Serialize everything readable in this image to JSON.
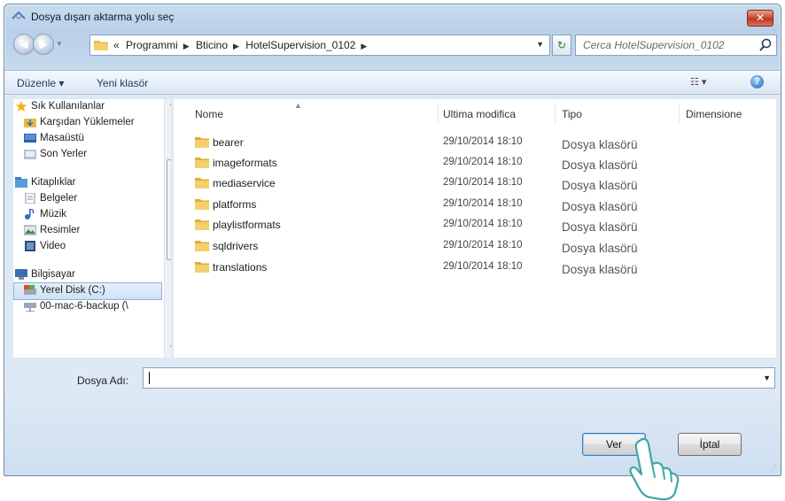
{
  "window": {
    "title": "Dosya dışarı aktarma yolu seç",
    "close_label": "✕"
  },
  "address": {
    "prefix": "«",
    "crumbs": [
      "Programmi",
      "Bticino",
      "HotelSupervision_0102"
    ],
    "search_placeholder": "Cerca HotelSupervision_0102"
  },
  "toolbar": {
    "organize": "Düzenle ▾",
    "new_folder": "Yeni klasör",
    "views_label": "☷ ▾",
    "help_label": "?"
  },
  "sidebar": {
    "items": [
      {
        "label": "Sık Kullanılanlar",
        "icon": "star-icon"
      },
      {
        "label": "Karşıdan Yüklemeler",
        "icon": "download-folder-icon"
      },
      {
        "label": "Masaüstü",
        "icon": "desktop-icon"
      },
      {
        "label": "Son Yerler",
        "icon": "recent-places-icon"
      },
      {
        "label": "Kitaplıklar",
        "icon": "libraries-icon"
      },
      {
        "label": "Belgeler",
        "icon": "documents-icon"
      },
      {
        "label": "Müzik",
        "icon": "music-icon"
      },
      {
        "label": "Resimler",
        "icon": "pictures-icon"
      },
      {
        "label": "Video",
        "icon": "video-icon"
      },
      {
        "label": "Bilgisayar",
        "icon": "computer-icon"
      },
      {
        "label": "Yerel Disk (C:)",
        "icon": "drive-icon"
      },
      {
        "label": "00-mac-6-backup (\\",
        "icon": "network-drive-icon"
      }
    ]
  },
  "columns": {
    "name": "Nome",
    "modified": "Ultima modifica",
    "type": "Tipo",
    "size": "Dimensione"
  },
  "files": [
    {
      "name": "bearer",
      "modified": "29/10/2014 18:10",
      "type": "Dosya klasörü"
    },
    {
      "name": "imageformats",
      "modified": "29/10/2014 18:10",
      "type": "Dosya klasörü"
    },
    {
      "name": "mediaservice",
      "modified": "29/10/2014 18:10",
      "type": "Dosya klasörü"
    },
    {
      "name": "platforms",
      "modified": "29/10/2014 18:10",
      "type": "Dosya klasörü"
    },
    {
      "name": "playlistformats",
      "modified": "29/10/2014 18:10",
      "type": "Dosya klasörü"
    },
    {
      "name": "sqldrivers",
      "modified": "29/10/2014 18:10",
      "type": "Dosya klasörü"
    },
    {
      "name": "translations",
      "modified": "29/10/2014 18:10",
      "type": "Dosya klasörü"
    }
  ],
  "filename": {
    "label": "Dosya Adı:",
    "value": ""
  },
  "buttons": {
    "ok": "Ver",
    "cancel": "İptal"
  },
  "colors": {
    "folder": "#e8b84a",
    "selection": "#cfe1f6",
    "frame": "#b9d0e8"
  }
}
